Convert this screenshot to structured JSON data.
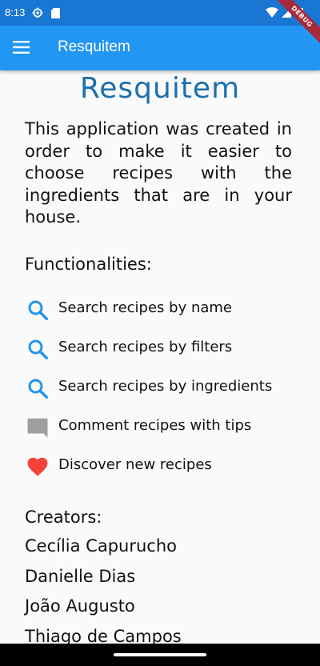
{
  "status_bar": {
    "time": "8:13",
    "icons": [
      "settings-gear-icon",
      "sd-card-icon",
      "wifi-icon",
      "signal-icon",
      "battery-icon"
    ]
  },
  "app_bar": {
    "title": "Resquitem",
    "menu_icon": "hamburger-menu-icon",
    "color": "#2196f3"
  },
  "debug_banner": "DEBUG",
  "main": {
    "brand_title": "Resquitem",
    "description": "This application was created in order to make it easier to choose recipes with the ingredients that are in your house.",
    "functionalities_heading": "Functionalities:",
    "functionalities": [
      {
        "icon": "search-icon",
        "label": "Search recipes by name"
      },
      {
        "icon": "search-icon",
        "label": "Search recipes by filters"
      },
      {
        "icon": "search-icon",
        "label": "Search recipes by ingredients"
      },
      {
        "icon": "comment-icon",
        "label": "Comment recipes with tips"
      },
      {
        "icon": "heart-icon",
        "label": "Discover new recipes"
      }
    ],
    "creators_heading": "Creators:",
    "creators": [
      "Cecília Capurucho",
      "Danielle Dias",
      "João Augusto",
      "Thiago de Campos"
    ]
  },
  "colors": {
    "brand_title": "#1b6fae",
    "search_icon": "#2196f3",
    "comment_icon": "#9e9e9e",
    "heart_icon": "#f44336"
  }
}
